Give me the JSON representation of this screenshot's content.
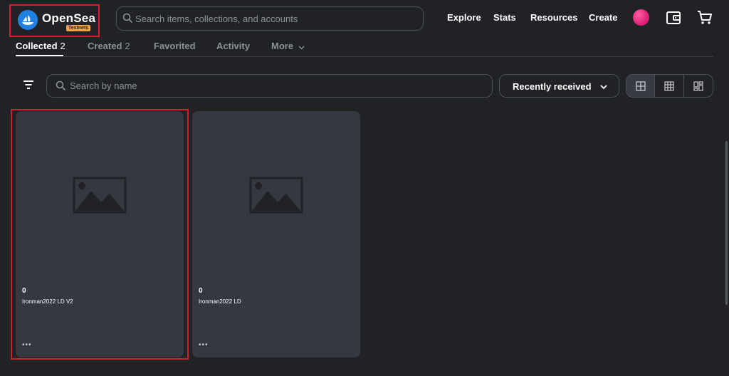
{
  "header": {
    "logo_text": "OpenSea",
    "badge": "Testnets",
    "search_placeholder": "Search items, collections, and accounts",
    "nav": [
      "Explore",
      "Stats",
      "Resources",
      "Create"
    ],
    "avatar_color": "#e0237a"
  },
  "tabs": [
    {
      "label": "Collected",
      "count": "2"
    },
    {
      "label": "Created",
      "count": "2"
    },
    {
      "label": "Favorited"
    },
    {
      "label": "Activity"
    },
    {
      "label": "More"
    }
  ],
  "toolbar": {
    "search_placeholder": "Search by name",
    "sort_label": "Recently received"
  },
  "items": [
    {
      "price": "0",
      "name": "Ironman2022 LD V2",
      "more": "•••"
    },
    {
      "price": "0",
      "name": "Ironman2022 LD",
      "more": "•••"
    }
  ],
  "colors": {
    "background": "#202225",
    "card": "#353840",
    "brand": "#2081e2",
    "badge": "#f1a244",
    "highlight": "#d4202a"
  },
  "icons": [
    "opensea-logo-icon",
    "search-icon",
    "wallet-icon",
    "cart-icon",
    "filter-icon",
    "chevron-down-icon",
    "grid-large-icon",
    "grid-small-icon",
    "grid-mixed-icon",
    "image-placeholder-icon"
  ]
}
